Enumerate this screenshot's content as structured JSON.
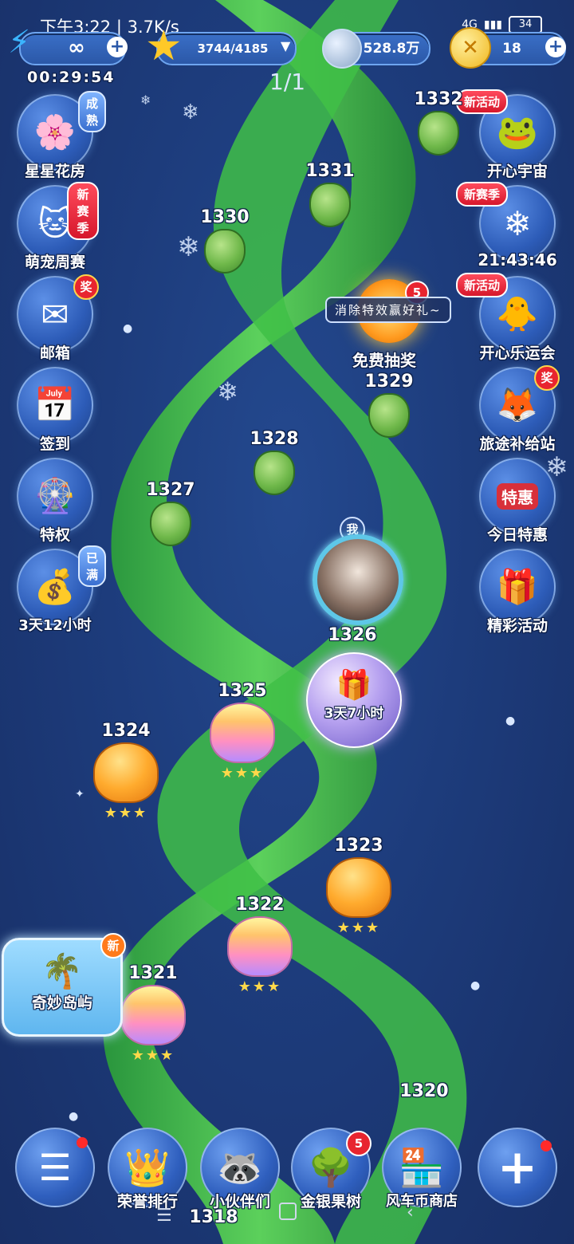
{
  "status_bar": {
    "time": "下午3:22 | 3.7K/s",
    "network": "4G",
    "battery": "34"
  },
  "currencies": {
    "lives": "∞",
    "stars": "3744/4185",
    "coins": "528.8万",
    "gold": "18"
  },
  "timer": "00:29:54",
  "page_indicator": "1/1",
  "left_menu": [
    {
      "label": "星星花房",
      "badge": "成熟",
      "icon": "flower-icon"
    },
    {
      "label": "萌宠周赛",
      "badge": "新赛季",
      "icon": "pet-icon"
    },
    {
      "label": "邮箱",
      "badge": "奖",
      "icon": "mail-icon"
    },
    {
      "label": "签到",
      "badge": "",
      "icon": "calendar-icon"
    },
    {
      "label": "特权",
      "badge": "",
      "icon": "privilege-icon"
    },
    {
      "label": "3天12小时",
      "badge": "已满",
      "icon": "treasure-icon"
    }
  ],
  "right_menu": [
    {
      "label": "开心宇宙",
      "badge": "新活动",
      "icon": "frog-icon"
    },
    {
      "label": "21:43:46",
      "badge": "新赛季",
      "icon": "crystal-icon"
    },
    {
      "label": "开心乐运会",
      "badge": "新活动",
      "icon": "chick-icon"
    },
    {
      "label": "旅途补给站",
      "badge": "奖",
      "icon": "supply-icon"
    },
    {
      "label": "今日特惠",
      "badge": "特惠",
      "icon": "shop-icon"
    },
    {
      "label": "精彩活动",
      "badge": "",
      "icon": "gift-icon"
    }
  ],
  "free_lottery": {
    "label": "免费抽奖",
    "tooltip": "消除特效赢好礼~",
    "badge": "5"
  },
  "levels": [
    {
      "num": "1331",
      "kind": "bud",
      "stars": ""
    },
    {
      "num": "1330",
      "kind": "bud",
      "stars": ""
    },
    {
      "num": "1329",
      "kind": "bud",
      "stars": ""
    },
    {
      "num": "1328",
      "kind": "bud",
      "stars": ""
    },
    {
      "num": "1327",
      "kind": "bud",
      "stars": ""
    },
    {
      "num": "1326",
      "kind": "gift",
      "stars": ""
    },
    {
      "num": "1325",
      "kind": "rainbow",
      "stars": "★★★"
    },
    {
      "num": "1324",
      "kind": "orange",
      "stars": "★★★"
    },
    {
      "num": "1323",
      "kind": "orange",
      "stars": "★★★"
    },
    {
      "num": "1322",
      "kind": "rainbow",
      "stars": "★★★"
    },
    {
      "num": "1321",
      "kind": "rainbow",
      "stars": "★★★"
    },
    {
      "num": "1320",
      "kind": "orange",
      "stars": ""
    },
    {
      "num": "1318",
      "kind": "rainbow",
      "stars": ""
    },
    {
      "num": "1332",
      "kind": "bud",
      "stars": ""
    }
  ],
  "player": {
    "me_label": "我",
    "gift_timer": "3天7小时"
  },
  "island": {
    "label": "奇妙岛屿",
    "badge": "新"
  },
  "bottom_bar": [
    {
      "label": "",
      "icon": "menu-icon"
    },
    {
      "label": "荣誉排行",
      "icon": "crown-icon"
    },
    {
      "label": "小伙伴们",
      "icon": "friends-icon"
    },
    {
      "label": "金银果树",
      "icon": "tree-icon",
      "badge": "5"
    },
    {
      "label": "风车币商店",
      "icon": "store-icon"
    },
    {
      "label": "",
      "icon": "plus-icon"
    }
  ]
}
